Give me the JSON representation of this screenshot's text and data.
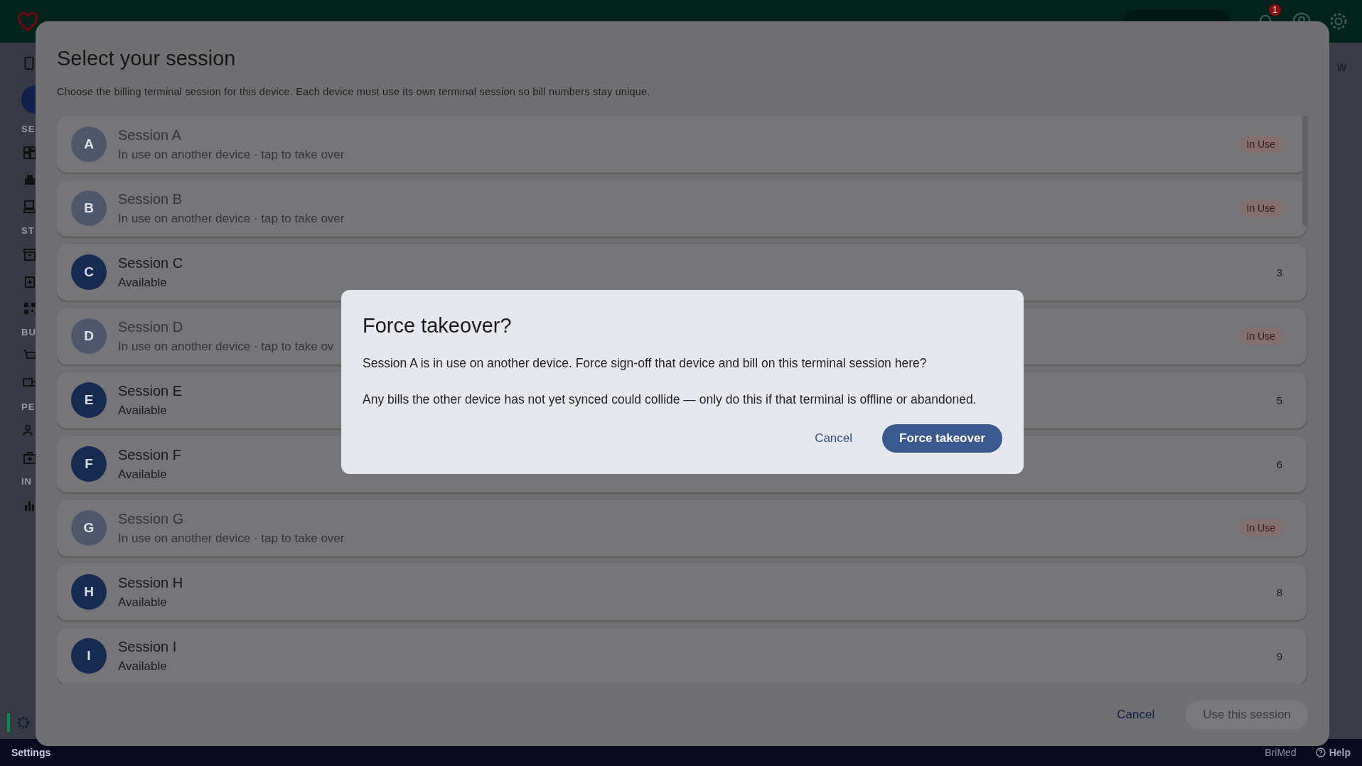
{
  "top_bar": {
    "notification_count": "1"
  },
  "page_heading": "w",
  "sidebar": {
    "sections": [
      {
        "label": "SE"
      },
      {
        "label": "ST"
      },
      {
        "label": "BU"
      },
      {
        "label": "PE"
      },
      {
        "label": "IN"
      }
    ],
    "settings_selected": true
  },
  "session_dialog": {
    "title": "Select your session",
    "description": "Choose the billing terminal session for this device. Each device must use its own terminal session so bill numbers stay unique.",
    "sessions": [
      {
        "letter": "A",
        "name": "Session A",
        "status": "In use on another device · tap to take over",
        "in_use": true,
        "trailing": "In Use"
      },
      {
        "letter": "B",
        "name": "Session B",
        "status": "In use on another device · tap to take over",
        "in_use": true,
        "trailing": "In Use"
      },
      {
        "letter": "C",
        "name": "Session C",
        "status": "Available",
        "in_use": false,
        "trailing": "3"
      },
      {
        "letter": "D",
        "name": "Session D",
        "status": "In use on another device · tap to take ov",
        "in_use": true,
        "trailing": "In Use"
      },
      {
        "letter": "E",
        "name": "Session E",
        "status": "Available",
        "in_use": false,
        "trailing": "5"
      },
      {
        "letter": "F",
        "name": "Session F",
        "status": "Available",
        "in_use": false,
        "trailing": "6"
      },
      {
        "letter": "G",
        "name": "Session G",
        "status": "In use on another device · tap to take over",
        "in_use": true,
        "trailing": "In Use"
      },
      {
        "letter": "H",
        "name": "Session H",
        "status": "Available",
        "in_use": false,
        "trailing": "8"
      },
      {
        "letter": "I",
        "name": "Session I",
        "status": "Available",
        "in_use": false,
        "trailing": "9"
      }
    ],
    "buttons": [
      {
        "label": "Cancel",
        "kind": "text",
        "disabled": false
      },
      {
        "label": "Use this session",
        "kind": "filled",
        "disabled": true
      }
    ]
  },
  "confirm_dialog": {
    "title": "Force takeover?",
    "paragraphs": [
      "Session A is in use on another device. Force sign-off that device and bill on this terminal session here?",
      "Any bills the other device has not yet synced could collide — only do this if that terminal is offline or abandoned."
    ],
    "buttons": [
      {
        "label": "Cancel",
        "kind": "text",
        "disabled": false
      },
      {
        "label": "Force takeover",
        "kind": "filled",
        "disabled": false
      }
    ]
  },
  "footer": {
    "left": "Settings",
    "brand": "BriMed",
    "help": "Help"
  }
}
